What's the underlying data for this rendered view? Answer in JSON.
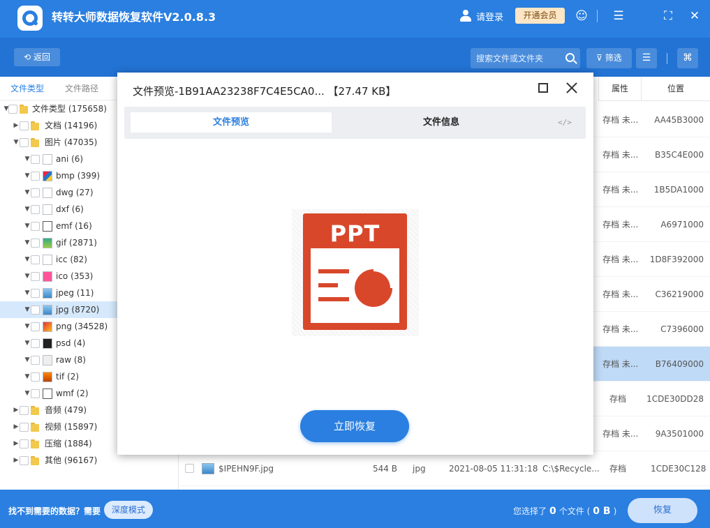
{
  "app": {
    "title": "转转大师数据恢复软件V2.0.8.3",
    "login_label": "请登录",
    "vip_label": "开通会员",
    "accent_color": "#2a7fe0"
  },
  "toolbar": {
    "back_label": "返回",
    "search_placeholder": "搜索文件或文件夹",
    "filter_label": "筛选"
  },
  "sidebar": {
    "tabs": [
      {
        "label": "文件类型",
        "active": true
      },
      {
        "label": "文件路径",
        "active": false
      }
    ],
    "tree": [
      {
        "label": "文件类型 (175658)",
        "level": 0,
        "arrow": "▼",
        "icon": "folder"
      },
      {
        "label": "文档 (14196)",
        "level": 1,
        "arrow": "▶",
        "icon": "folder"
      },
      {
        "label": "图片 (47035)",
        "level": 1,
        "arrow": "▼",
        "icon": "folder"
      },
      {
        "label": "ani (6)",
        "level": 2,
        "arrow": "▼",
        "icon": "ani"
      },
      {
        "label": "bmp (399)",
        "level": 2,
        "arrow": "▼",
        "icon": "bmp"
      },
      {
        "label": "dwg (27)",
        "level": 2,
        "arrow": "▼",
        "icon": "dwg"
      },
      {
        "label": "dxf (6)",
        "level": 2,
        "arrow": "▼",
        "icon": "dxf"
      },
      {
        "label": "emf (16)",
        "level": 2,
        "arrow": "▼",
        "icon": "emf"
      },
      {
        "label": "gif (2871)",
        "level": 2,
        "arrow": "▼",
        "icon": "gif"
      },
      {
        "label": "icc (82)",
        "level": 2,
        "arrow": "▼",
        "icon": "icc"
      },
      {
        "label": "ico (353)",
        "level": 2,
        "arrow": "▼",
        "icon": "ico"
      },
      {
        "label": "jpeg (11)",
        "level": 2,
        "arrow": "▼",
        "icon": "jpeg"
      },
      {
        "label": "jpg (8720)",
        "level": 2,
        "arrow": "▼",
        "icon": "jpg",
        "selected": true
      },
      {
        "label": "png (34528)",
        "level": 2,
        "arrow": "▼",
        "icon": "png"
      },
      {
        "label": "psd (4)",
        "level": 2,
        "arrow": "▼",
        "icon": "psd"
      },
      {
        "label": "raw (8)",
        "level": 2,
        "arrow": "▼",
        "icon": "raw"
      },
      {
        "label": "tif (2)",
        "level": 2,
        "arrow": "▼",
        "icon": "tif"
      },
      {
        "label": "wmf (2)",
        "level": 2,
        "arrow": "▼",
        "icon": "wmf"
      },
      {
        "label": "音频 (479)",
        "level": 1,
        "arrow": "▶",
        "icon": "folder"
      },
      {
        "label": "视频 (15897)",
        "level": 1,
        "arrow": "▶",
        "icon": "folder"
      },
      {
        "label": "压缩 (1884)",
        "level": 1,
        "arrow": "▶",
        "icon": "folder"
      },
      {
        "label": "其他 (96167)",
        "level": 1,
        "arrow": "▶",
        "icon": "folder"
      }
    ]
  },
  "list": {
    "headers": {
      "attr": "属性",
      "location": "位置"
    },
    "rows": [
      {
        "attr": "存档 未...",
        "location": "AA45B3000"
      },
      {
        "attr": "存档 未...",
        "location": "B35C4E000"
      },
      {
        "attr": "存档 未...",
        "location": "1B5DA1000"
      },
      {
        "attr": "存档 未...",
        "location": "A6971000"
      },
      {
        "attr": "存档 未...",
        "location": "1D8F392000"
      },
      {
        "attr": "存档 未...",
        "location": "C36219000"
      },
      {
        "attr": "存档 未...",
        "location": "C7396000"
      },
      {
        "attr": "存档 未...",
        "location": "B76409000",
        "highlight": true
      },
      {
        "attr": "存档",
        "location": "1CDE30DD28"
      },
      {
        "attr": "存档 未...",
        "location": "9A3501000"
      }
    ],
    "full_row": {
      "name": "$IPEHN9F.jpg",
      "size": "544 B",
      "type": "jpg",
      "date": "2021-08-05 11:31:18",
      "path": "C:\\$Recycle...",
      "attr": "存档",
      "location": "1CDE30C128"
    }
  },
  "modal": {
    "title": "文件预览-1B91AA23238F7C4E5CA0... 【27.47 KB】",
    "tab_preview": "文件预览",
    "tab_info": "文件信息",
    "code_label": "</>",
    "ppt_label": "PPT",
    "restore_label": "立即恢复"
  },
  "status": {
    "prompt": "找不到需要的数据？需要",
    "deep_mode_label": "深度模式",
    "selected_prefix": "您选择了",
    "selected_count": "0",
    "selected_mid": "个文件 (",
    "selected_size": "0 B",
    "selected_suffix": ")",
    "recover_label": "恢复"
  }
}
